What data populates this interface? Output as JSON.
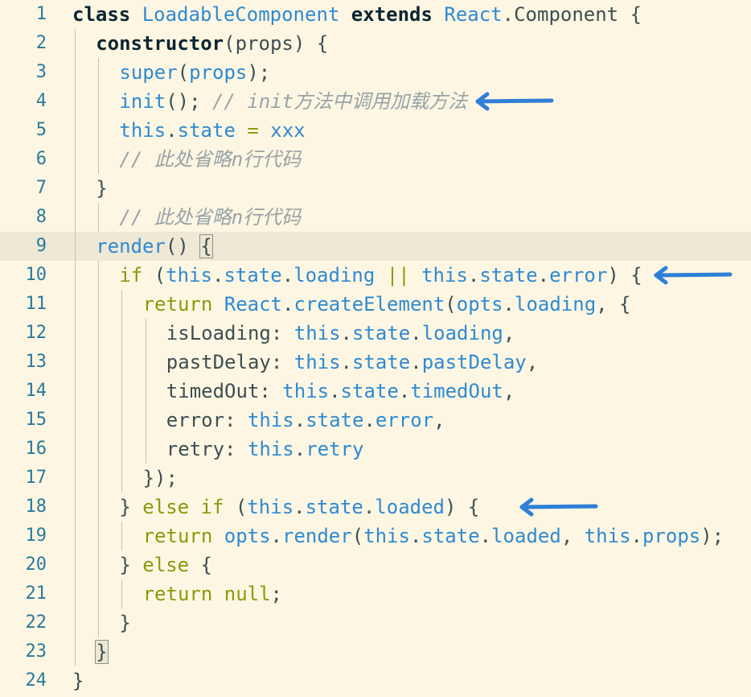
{
  "editor": {
    "lines": [
      {
        "num": "1",
        "indent": 0,
        "tokens": [
          [
            "kw",
            "class "
          ],
          [
            "cls",
            "LoadableComponent "
          ],
          [
            "kw",
            "extends "
          ],
          [
            "cls",
            "React"
          ],
          [
            "id",
            ".Component {"
          ]
        ]
      },
      {
        "num": "2",
        "indent": 1,
        "tokens": [
          [
            "kw",
            "constructor"
          ],
          [
            "id",
            "(props) {"
          ]
        ]
      },
      {
        "num": "3",
        "indent": 2,
        "tokens": [
          [
            "fn",
            "super"
          ],
          [
            "id",
            "("
          ],
          [
            "fn",
            "props"
          ],
          [
            "id",
            ");"
          ]
        ]
      },
      {
        "num": "4",
        "indent": 2,
        "tokens": [
          [
            "fn",
            "init"
          ],
          [
            "id",
            "(); "
          ],
          [
            "cm",
            "// init方法中调用加载方法"
          ]
        ]
      },
      {
        "num": "5",
        "indent": 2,
        "tokens": [
          [
            "fn",
            "this"
          ],
          [
            "id",
            "."
          ],
          [
            "fn",
            "state "
          ],
          [
            "op",
            "= "
          ],
          [
            "fn",
            "xxx"
          ]
        ]
      },
      {
        "num": "6",
        "indent": 2,
        "tokens": [
          [
            "cm",
            "// 此处省略n行代码"
          ]
        ]
      },
      {
        "num": "7",
        "indent": 1,
        "tokens": [
          [
            "id",
            "}"
          ]
        ]
      },
      {
        "num": "8",
        "indent": 2,
        "tokens": [
          [
            "cm",
            "// 此处省略n行代码"
          ]
        ]
      },
      {
        "num": "9",
        "indent": 1,
        "current": true,
        "tokens": [
          [
            "fn",
            "render"
          ],
          [
            "id",
            "() "
          ],
          [
            "hl",
            "{"
          ]
        ]
      },
      {
        "num": "10",
        "indent": 2,
        "tokens": [
          [
            "ctl",
            "if "
          ],
          [
            "id",
            "("
          ],
          [
            "fn",
            "this"
          ],
          [
            "id",
            "."
          ],
          [
            "fn",
            "state"
          ],
          [
            "id",
            "."
          ],
          [
            "fn",
            "loading "
          ],
          [
            "op",
            "|| "
          ],
          [
            "fn",
            "this"
          ],
          [
            "id",
            "."
          ],
          [
            "fn",
            "state"
          ],
          [
            "id",
            "."
          ],
          [
            "fn",
            "error"
          ],
          [
            "id",
            ") {"
          ]
        ]
      },
      {
        "num": "11",
        "indent": 3,
        "tokens": [
          [
            "ctl",
            "return "
          ],
          [
            "fn",
            "React"
          ],
          [
            "id",
            "."
          ],
          [
            "fn",
            "createElement"
          ],
          [
            "id",
            "("
          ],
          [
            "fn",
            "opts"
          ],
          [
            "id",
            "."
          ],
          [
            "fn",
            "loading"
          ],
          [
            "id",
            ", {"
          ]
        ]
      },
      {
        "num": "12",
        "indent": 4,
        "tokens": [
          [
            "id",
            "isLoading: "
          ],
          [
            "fn",
            "this"
          ],
          [
            "id",
            "."
          ],
          [
            "fn",
            "state"
          ],
          [
            "id",
            "."
          ],
          [
            "fn",
            "loading"
          ],
          [
            "id",
            ","
          ]
        ]
      },
      {
        "num": "13",
        "indent": 4,
        "tokens": [
          [
            "id",
            "pastDelay: "
          ],
          [
            "fn",
            "this"
          ],
          [
            "id",
            "."
          ],
          [
            "fn",
            "state"
          ],
          [
            "id",
            "."
          ],
          [
            "fn",
            "pastDelay"
          ],
          [
            "id",
            ","
          ]
        ]
      },
      {
        "num": "14",
        "indent": 4,
        "tokens": [
          [
            "id",
            "timedOut: "
          ],
          [
            "fn",
            "this"
          ],
          [
            "id",
            "."
          ],
          [
            "fn",
            "state"
          ],
          [
            "id",
            "."
          ],
          [
            "fn",
            "timedOut"
          ],
          [
            "id",
            ","
          ]
        ]
      },
      {
        "num": "15",
        "indent": 4,
        "tokens": [
          [
            "id",
            "error: "
          ],
          [
            "fn",
            "this"
          ],
          [
            "id",
            "."
          ],
          [
            "fn",
            "state"
          ],
          [
            "id",
            "."
          ],
          [
            "fn",
            "error"
          ],
          [
            "id",
            ","
          ]
        ]
      },
      {
        "num": "16",
        "indent": 4,
        "tokens": [
          [
            "id",
            "retry: "
          ],
          [
            "fn",
            "this"
          ],
          [
            "id",
            "."
          ],
          [
            "fn",
            "retry"
          ]
        ]
      },
      {
        "num": "17",
        "indent": 3,
        "tokens": [
          [
            "id",
            "});"
          ]
        ]
      },
      {
        "num": "18",
        "indent": 2,
        "tokens": [
          [
            "id",
            "} "
          ],
          [
            "ctl",
            "else if "
          ],
          [
            "id",
            "("
          ],
          [
            "fn",
            "this"
          ],
          [
            "id",
            "."
          ],
          [
            "fn",
            "state"
          ],
          [
            "id",
            "."
          ],
          [
            "fn",
            "loaded"
          ],
          [
            "id",
            ") {"
          ]
        ]
      },
      {
        "num": "19",
        "indent": 3,
        "tokens": [
          [
            "ctl",
            "return "
          ],
          [
            "fn",
            "opts"
          ],
          [
            "id",
            "."
          ],
          [
            "fn",
            "render"
          ],
          [
            "id",
            "("
          ],
          [
            "fn",
            "this"
          ],
          [
            "id",
            "."
          ],
          [
            "fn",
            "state"
          ],
          [
            "id",
            "."
          ],
          [
            "fn",
            "loaded"
          ],
          [
            "id",
            ", "
          ],
          [
            "fn",
            "this"
          ],
          [
            "id",
            "."
          ],
          [
            "fn",
            "props"
          ],
          [
            "id",
            ");"
          ]
        ]
      },
      {
        "num": "20",
        "indent": 2,
        "tokens": [
          [
            "id",
            "} "
          ],
          [
            "ctl",
            "else "
          ],
          [
            "id",
            "{"
          ]
        ]
      },
      {
        "num": "21",
        "indent": 3,
        "tokens": [
          [
            "ctl",
            "return null"
          ],
          [
            "id",
            ";"
          ]
        ]
      },
      {
        "num": "22",
        "indent": 2,
        "tokens": [
          [
            "id",
            "}"
          ]
        ]
      },
      {
        "num": "23",
        "indent": 1,
        "tokens": [
          [
            "hl",
            "}"
          ]
        ]
      },
      {
        "num": "24",
        "indent": 0,
        "tokens": [
          [
            "id",
            "}"
          ]
        ]
      }
    ]
  },
  "annotations": {
    "arrow_color": "#2f7fd6",
    "arrows": [
      {
        "name": "arrow-line-4",
        "line": 4
      },
      {
        "name": "arrow-line-10",
        "line": 10
      },
      {
        "name": "arrow-line-18",
        "line": 18
      }
    ]
  }
}
